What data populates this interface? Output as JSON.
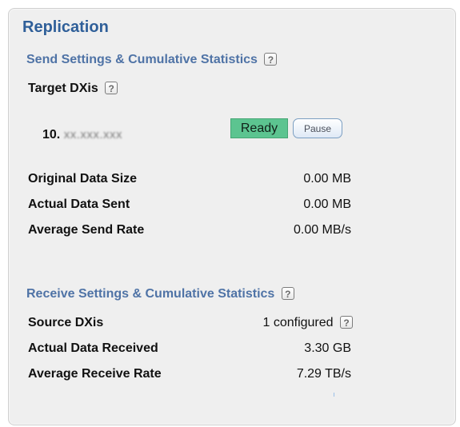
{
  "panel": {
    "title": "Replication"
  },
  "send": {
    "section_title": "Send Settings & Cumulative Statistics",
    "target_label": "Target DXis",
    "target_ip_prefix": "10.",
    "target_ip_redacted": "xx.xxx.xxx",
    "status_label": "Ready",
    "pause_label": "Pause",
    "stats": [
      {
        "label": "Original Data Size",
        "value": "0.00 MB"
      },
      {
        "label": "Actual Data Sent",
        "value": "0.00 MB"
      },
      {
        "label": "Average Send Rate",
        "value": "0.00 MB/s"
      }
    ]
  },
  "receive": {
    "section_title": "Receive Settings & Cumulative Statistics",
    "source_label": "Source DXis",
    "source_value": "1 configured",
    "stats": [
      {
        "label": "Actual Data Received",
        "value": "3.30 GB"
      },
      {
        "label": "Average Receive Rate",
        "value": "7.29 TB/s"
      }
    ]
  },
  "help_icon": {
    "glyph": "?"
  },
  "colors": {
    "title": "#2f5f99",
    "section_title": "#4f73a6",
    "ready": "#5cc490",
    "panel_background": "#efefef"
  }
}
